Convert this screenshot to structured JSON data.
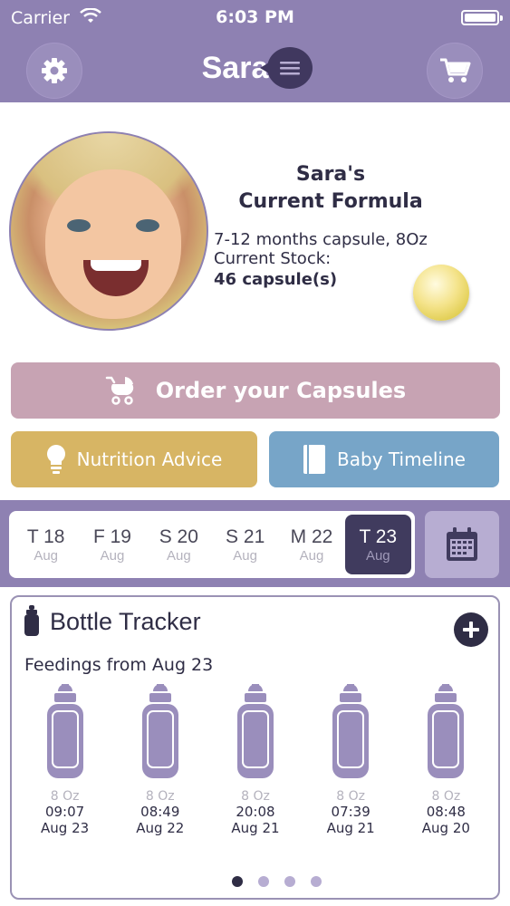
{
  "status_bar": {
    "carrier": "Carrier",
    "time": "6:03 PM"
  },
  "nav": {
    "title": "Sara",
    "settings_icon": "gear-icon",
    "menu_icon": "menu-icon",
    "cart_icon": "cart-icon"
  },
  "profile": {
    "title_line1": "Sara's",
    "title_line2": "Current Formula",
    "capsule": "7-12 months capsule, 8Oz",
    "stock_label": "Current Stock:",
    "stock_value": "46 capsule(s)"
  },
  "actions": {
    "order": "Order your Capsules",
    "nutrition": "Nutrition Advice",
    "timeline": "Baby Timeline"
  },
  "dates": [
    {
      "day": "T 18",
      "month": "Aug",
      "active": false
    },
    {
      "day": "F 19",
      "month": "Aug",
      "active": false
    },
    {
      "day": "S 20",
      "month": "Aug",
      "active": false
    },
    {
      "day": "S 21",
      "month": "Aug",
      "active": false
    },
    {
      "day": "M 22",
      "month": "Aug",
      "active": false
    },
    {
      "day": "T 23",
      "month": "Aug",
      "active": true
    }
  ],
  "tracker": {
    "title": "Bottle Tracker",
    "feedings_title": "Feedings from Aug 23",
    "bottles": [
      {
        "oz": "8 Oz",
        "time": "09:07",
        "date": "Aug 23"
      },
      {
        "oz": "8 Oz",
        "time": "08:49",
        "date": "Aug 22"
      },
      {
        "oz": "8 Oz",
        "time": "20:08",
        "date": "Aug 21"
      },
      {
        "oz": "8 Oz",
        "time": "07:39",
        "date": "Aug 21"
      },
      {
        "oz": "8 Oz",
        "time": "08:48",
        "date": "Aug 20"
      }
    ],
    "page_count": 4,
    "current_page": 1
  },
  "colors": {
    "header": "#8e81b2",
    "order_button": "#c7a3b3",
    "nutrition_button": "#d7b564",
    "timeline_button": "#77a5c8",
    "active_date": "#403b5e",
    "bottle": "#9a8ebc"
  }
}
